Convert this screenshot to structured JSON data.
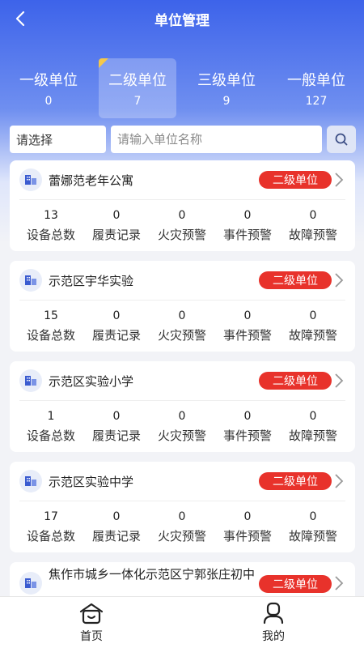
{
  "header": {
    "title": "单位管理"
  },
  "levels": [
    {
      "label": "一级单位",
      "count": "0"
    },
    {
      "label": "二级单位",
      "count": "7"
    },
    {
      "label": "三级单位",
      "count": "9"
    },
    {
      "label": "一般单位",
      "count": "127"
    }
  ],
  "active_level": "二级单位",
  "search": {
    "select_value": "请选择",
    "placeholder": "请输入单位名称",
    "input_value": ""
  },
  "stat_labels": [
    "设备总数",
    "履责记录",
    "火灾预警",
    "事件预警",
    "故障预警"
  ],
  "units": [
    {
      "name": "蕾娜范老年公寓",
      "level": "二级单位",
      "stats": [
        "13",
        "0",
        "0",
        "0",
        "0"
      ]
    },
    {
      "name": "示范区宇华实验",
      "level": "二级单位",
      "stats": [
        "15",
        "0",
        "0",
        "0",
        "0"
      ]
    },
    {
      "name": "示范区实验小学",
      "level": "二级单位",
      "stats": [
        "1",
        "0",
        "0",
        "0",
        "0"
      ]
    },
    {
      "name": "示范区实验中学",
      "level": "二级单位",
      "stats": [
        "17",
        "0",
        "0",
        "0",
        "0"
      ]
    },
    {
      "name": "焦作市城乡一体化示范区宁郭张庄初中",
      "level": "二级单位",
      "stats": []
    }
  ],
  "bottom_nav": [
    {
      "label": "首页",
      "icon": "home-icon"
    },
    {
      "label": "我的",
      "icon": "profile-icon"
    }
  ],
  "colors": {
    "primary": "#3d63ea",
    "badge": "#e8322b",
    "active_corner": "#f5c84a"
  }
}
